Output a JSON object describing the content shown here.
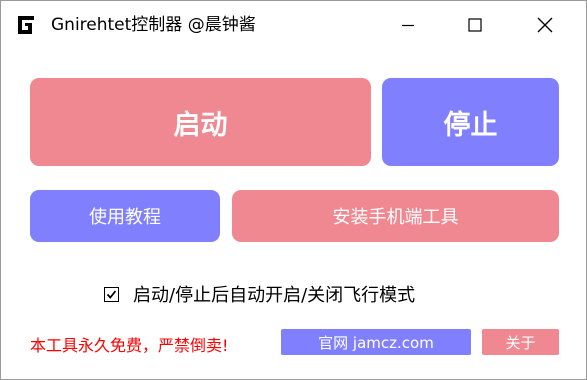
{
  "window": {
    "title": "Gnirehtet控制器 @晨钟酱",
    "icon": "g-logo-icon",
    "controls": [
      "minimize-icon",
      "maximize-icon",
      "close-icon"
    ]
  },
  "buttons": {
    "start_label": "启动",
    "stop_label": "停止",
    "tutorial_label": "使用教程",
    "install_label": "安装手机端工具"
  },
  "options": {
    "auto_airplane_label": "启动/停止后自动开启/关闭飞行模式",
    "auto_airplane_checked": true
  },
  "footer": {
    "notice": "本工具永久免费，严禁倒卖!",
    "site_label": "官网 jamcz.com",
    "about_label": "关于"
  },
  "colors": {
    "pink": "#f08892",
    "purple": "#8080ff",
    "notice_red": "#ff0000"
  }
}
